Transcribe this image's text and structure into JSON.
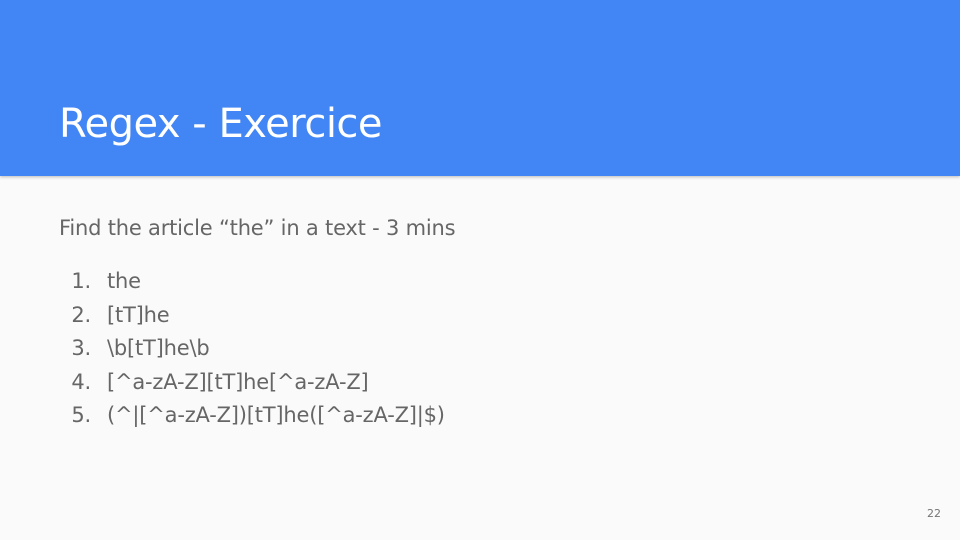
{
  "slide": {
    "title": "Regex - Exercice",
    "subtitle": "Find the article “the” in a text - 3 mins",
    "items": [
      {
        "number": "1.",
        "text": "the"
      },
      {
        "number": "2.",
        "text": "[tT]he"
      },
      {
        "number": "3.",
        "text": "\\b[tT]he\\b"
      },
      {
        "number": "4.",
        "text": "[^a-zA-Z][tT]he[^a-zA-Z]"
      },
      {
        "number": "5.",
        "text": "(^|[^a-zA-Z])[tT]he([^a-zA-Z]|$)"
      }
    ],
    "page_number": "22"
  },
  "colors": {
    "header_background": "#4285f4",
    "title_text": "#ffffff",
    "body_text": "#666666",
    "slide_background": "#fafafa"
  }
}
